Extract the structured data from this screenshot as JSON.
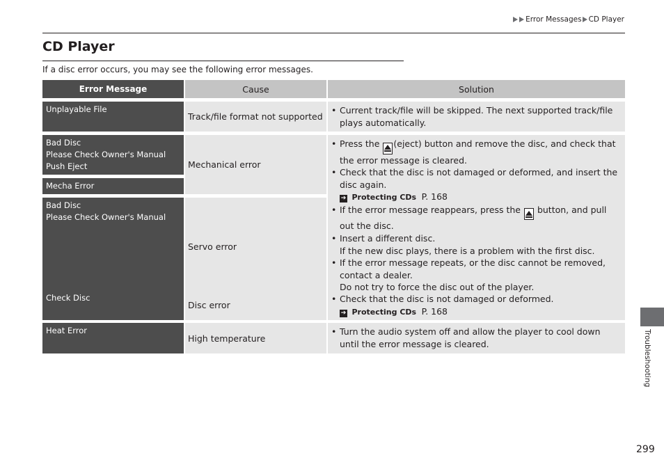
{
  "breadcrumb": {
    "items": [
      "Error Messages",
      "CD Player"
    ]
  },
  "page": {
    "title": "CD Player",
    "intro": "If a disc error occurs, you may see the following error messages.",
    "section_tab": "Troubleshooting",
    "page_number": "299"
  },
  "table": {
    "headers": {
      "message": "Error Message",
      "cause": "Cause",
      "solution": "Solution"
    },
    "rows": [
      {
        "messages": [
          [
            "Unplayable File"
          ]
        ],
        "cause": "Track/file format not supported",
        "solution": {
          "b0": "Current track/file will be skipped. The next supported track/file plays automatically."
        }
      },
      {
        "messages": [
          [
            "Bad Disc",
            "Please Check Owner's Manual",
            "Push Eject"
          ],
          [
            "Mecha Error"
          ],
          [
            "Bad Disc",
            "Please Check Owner's Manual"
          ]
        ],
        "causes": [
          "Mechanical error",
          "Servo error"
        ],
        "solution": {
          "b0_pre": "Press the",
          "b0_post": "(eject) button and remove the disc, and check that the error message is cleared.",
          "b1": "Check that the disc is not damaged or deformed, and insert the disc again.",
          "b1_ref_title": "Protecting CDs",
          "b1_ref_page": "P. 168",
          "b2_pre": "If the error message reappears, press the",
          "b2_post": "button, and pull out the disc.",
          "b3": "Insert a different disc.",
          "b3_sub": "If the new disc plays, there is a problem with the first disc.",
          "b4": "If the error message repeats, or the disc cannot be removed, contact a dealer.",
          "b4_sub": "Do not try to force the disc out of the player."
        }
      },
      {
        "messages": [
          [
            "Check Disc"
          ]
        ],
        "cause": "Disc error",
        "solution": {
          "b0": "Check that the disc is not damaged or deformed.",
          "ref_title": "Protecting CDs",
          "ref_page": "P. 168"
        }
      },
      {
        "messages": [
          [
            "Heat Error"
          ]
        ],
        "cause": "High temperature",
        "solution": {
          "b0": "Turn the audio system off and allow the player to cool down until the error message is cleared."
        }
      }
    ]
  },
  "icons": {
    "eject": "eject-icon",
    "reference": "reference-arrow-icon",
    "breadcrumb": "breadcrumb-triangle-icon"
  }
}
